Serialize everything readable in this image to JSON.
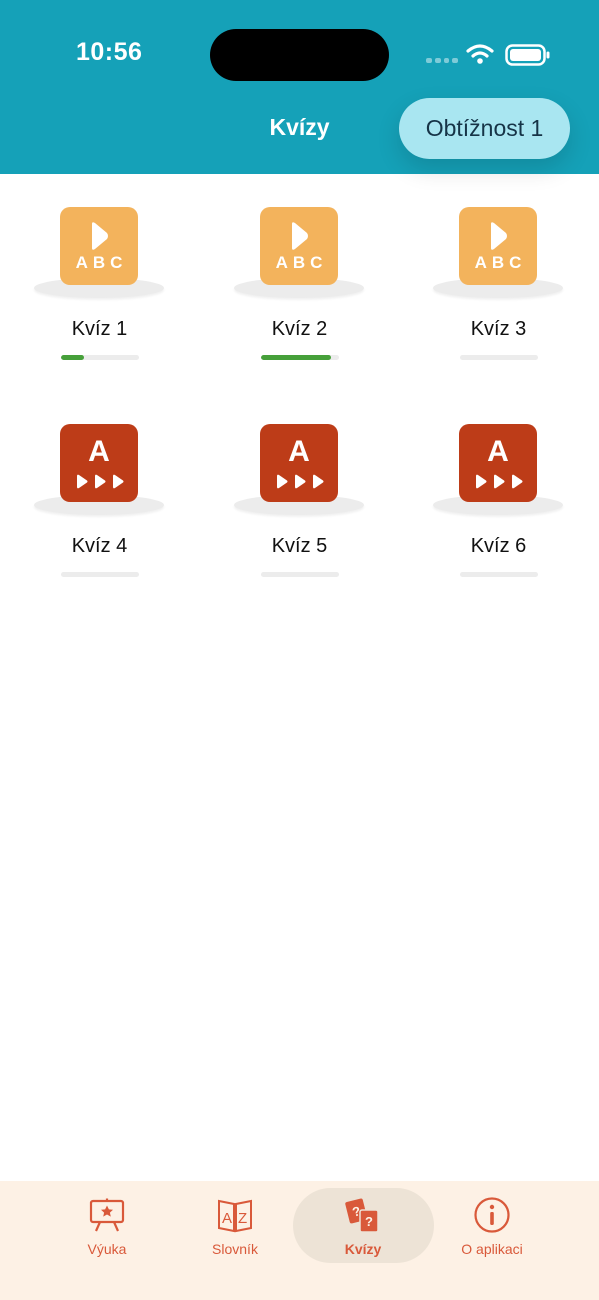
{
  "status_bar": {
    "time": "10:56"
  },
  "header": {
    "title": "Kvízy",
    "difficulty_label": "Obtížnost 1"
  },
  "icon_text": {
    "abc": "ABC",
    "a": "A"
  },
  "quizzes": [
    {
      "label": "Kvíz 1",
      "icon": "abc-play-icon",
      "progress": 0.3
    },
    {
      "label": "Kvíz 2",
      "icon": "abc-play-icon",
      "progress": 0.9
    },
    {
      "label": "Kvíz 3",
      "icon": "abc-play-icon",
      "progress": 0
    },
    {
      "label": "Kvíz 4",
      "icon": "a-triangles-icon",
      "progress": 0
    },
    {
      "label": "Kvíz 5",
      "icon": "a-triangles-icon",
      "progress": 0
    },
    {
      "label": "Kvíz 6",
      "icon": "a-triangles-icon",
      "progress": 0
    }
  ],
  "tabs": [
    {
      "label": "Výuka",
      "icon": "easel-star-icon",
      "active": false
    },
    {
      "label": "Slovník",
      "icon": "book-az-icon",
      "active": false
    },
    {
      "label": "Kvízy",
      "icon": "question-cards-icon",
      "active": true
    },
    {
      "label": "O aplikaci",
      "icon": "info-icon",
      "active": false
    }
  ],
  "colors": {
    "header": "#15a1b8",
    "difficulty_button": "#a9e6f1",
    "quiz_abc": "#f3b35c",
    "quiz_a": "#bd3c18",
    "progress": "#46a03a",
    "tab_accent": "#d9593a",
    "tab_bar": "#fdf1e5"
  }
}
